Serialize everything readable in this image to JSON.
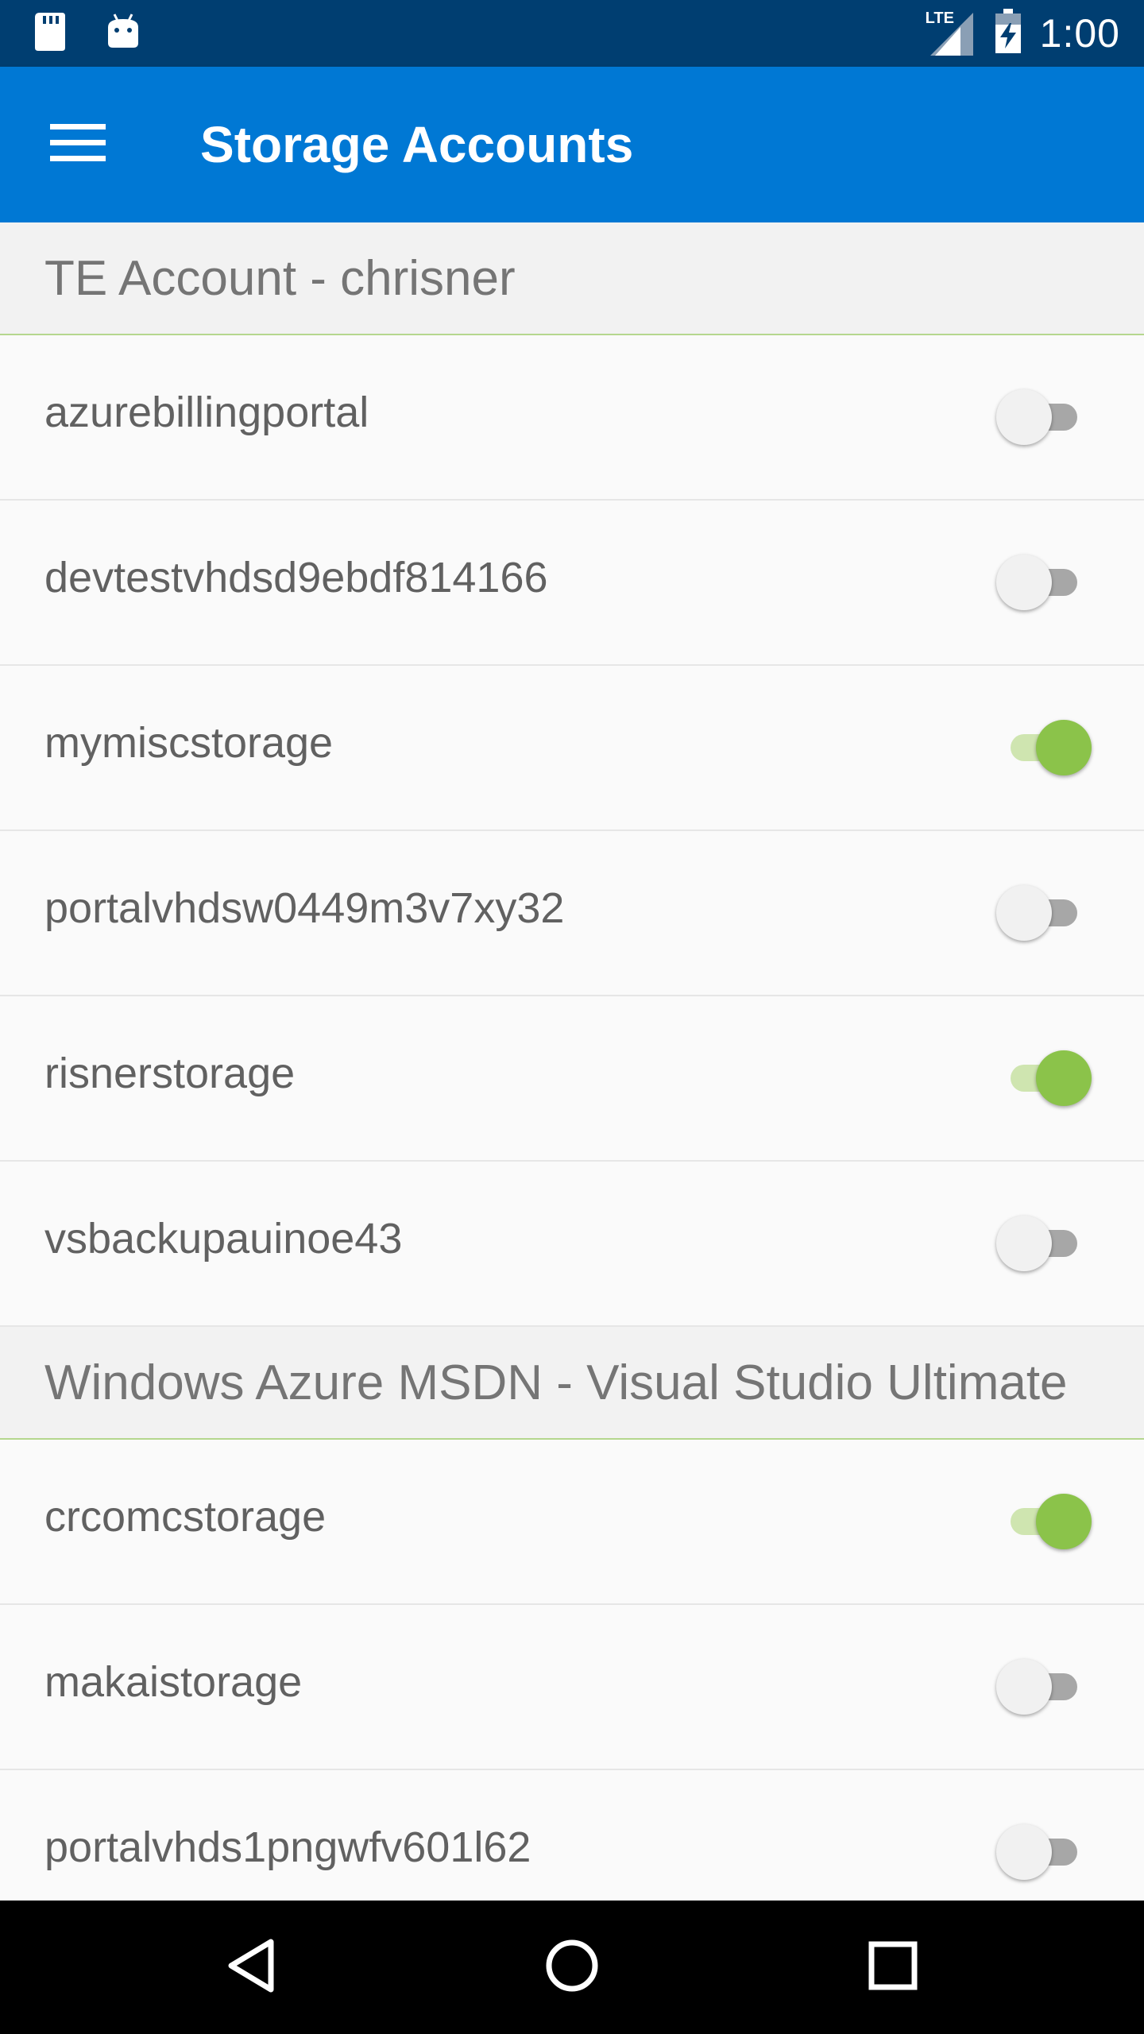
{
  "status_bar": {
    "time": "1:00",
    "network_label": "LTE",
    "icons": [
      "sd-card-icon",
      "android-icon",
      "signal-icon",
      "battery-charging-icon"
    ]
  },
  "app_bar": {
    "title": "Storage Accounts",
    "menu_icon": "hamburger-menu-icon",
    "background_color": "#0078d4"
  },
  "sections": [
    {
      "header": "TE Account - chrisner",
      "items": [
        {
          "label": "azurebillingportal",
          "enabled": false
        },
        {
          "label": "devtestvhdsd9ebdf814166",
          "enabled": false
        },
        {
          "label": "mymiscstorage",
          "enabled": true
        },
        {
          "label": "portalvhdsw0449m3v7xy32",
          "enabled": false
        },
        {
          "label": "risnerstorage",
          "enabled": true
        },
        {
          "label": "vsbackupauinoe43",
          "enabled": false
        }
      ]
    },
    {
      "header": "Windows Azure MSDN - Visual Studio Ultimate",
      "items": [
        {
          "label": "crcomcstorage",
          "enabled": true
        },
        {
          "label": "makaistorage",
          "enabled": false
        },
        {
          "label": "portalvhds1pngwfv601l62",
          "enabled": false
        }
      ]
    }
  ],
  "colors": {
    "toggle_on": "#8bc34a",
    "toggle_on_track": "#cfe5b0",
    "toggle_off_track": "#a7a7a7",
    "status_bar": "#003e71"
  },
  "nav_bar": {
    "back_icon": "back-triangle-icon",
    "home_icon": "home-circle-icon",
    "recents_icon": "recents-square-icon"
  }
}
